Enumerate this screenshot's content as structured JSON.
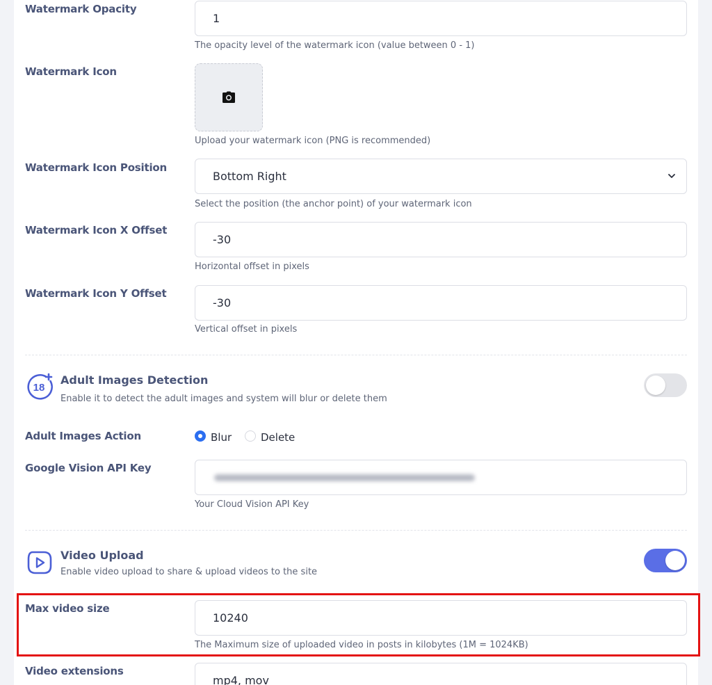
{
  "watermark_opacity": {
    "label": "Watermark Opacity",
    "value": "1",
    "help": "The opacity level of the watermark icon (value between 0 - 1)"
  },
  "watermark_icon": {
    "label": "Watermark Icon",
    "icon": "camera-icon",
    "help": "Upload your watermark icon (PNG is recommended)"
  },
  "watermark_position": {
    "label": "Watermark Icon Position",
    "selected": "Bottom Right",
    "help": "Select the position (the anchor point) of your watermark icon"
  },
  "watermark_x_offset": {
    "label": "Watermark Icon X Offset",
    "value": "-30",
    "help": "Horizontal offset in pixels"
  },
  "watermark_y_offset": {
    "label": "Watermark Icon Y Offset",
    "value": "-30",
    "help": "Vertical offset in pixels"
  },
  "adult_detection": {
    "icon": "18-plus-icon",
    "icon_text": "18",
    "title": "Adult Images Detection",
    "subtitle": "Enable it to detect the adult images and system will blur or delete them",
    "enabled": false
  },
  "adult_action": {
    "label": "Adult Images Action",
    "options": [
      "Blur",
      "Delete"
    ],
    "selected": "Blur"
  },
  "vision_api": {
    "label": "Google Vision API Key",
    "help": "Your Cloud Vision API Key"
  },
  "video_upload": {
    "icon": "video-play-icon",
    "title": "Video Upload",
    "subtitle": "Enable video upload to share & upload videos to the site",
    "enabled": true
  },
  "max_video_size": {
    "label": "Max video size",
    "value": "10240",
    "help": "The Maximum size of uploaded video in posts in kilobytes (1M = 1024KB)"
  },
  "video_extensions": {
    "label": "Video extensions",
    "value": "mp4, mov"
  },
  "colors": {
    "accent": "#5a6ee6",
    "radio": "#2b6ef0",
    "highlight": "#e41313",
    "label": "#4a5578"
  }
}
